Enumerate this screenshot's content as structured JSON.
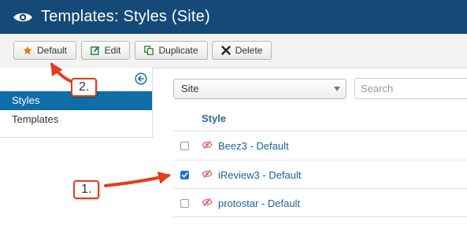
{
  "header": {
    "title": "Templates: Styles (Site)"
  },
  "toolbar": {
    "default_label": "Default",
    "edit_label": "Edit",
    "duplicate_label": "Duplicate",
    "delete_label": "Delete"
  },
  "sidebar": {
    "items": [
      {
        "label": "Styles",
        "active": true
      },
      {
        "label": "Templates",
        "active": false
      }
    ]
  },
  "filter": {
    "selected": "Site",
    "search_placeholder": "Search"
  },
  "table": {
    "column_header": "Style",
    "rows": [
      {
        "name": "Beez3 - Default",
        "checked": false
      },
      {
        "name": "iReview3 - Default",
        "checked": true
      },
      {
        "name": "protostar - Default",
        "checked": false
      }
    ]
  },
  "annotations": {
    "step1": "1.",
    "step2": "2."
  },
  "colors": {
    "header_bg": "#154a78",
    "active_item_bg": "#0f6ea8",
    "link": "#1f5f9a",
    "callout_border": "#e53d1b",
    "star": "#e07a10"
  }
}
